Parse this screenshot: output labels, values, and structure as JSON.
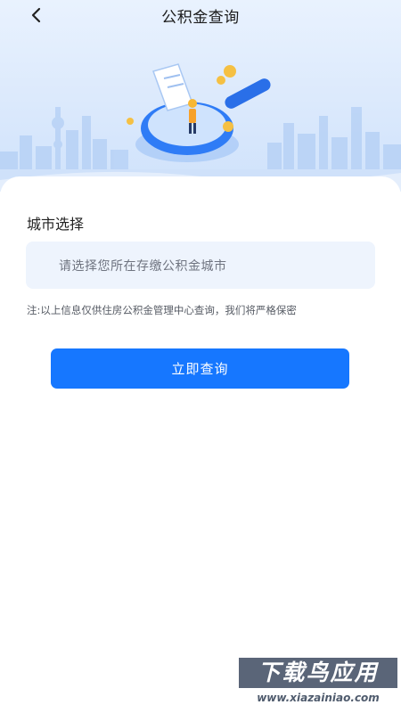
{
  "header": {
    "title": "公积金查询"
  },
  "form": {
    "section_label": "城市选择",
    "city_placeholder": "请选择您所在存缴公积金城市",
    "note": "注:以上信息仅供住房公积金管理中心查询，我们将严格保密",
    "submit_label": "立即查询"
  },
  "watermark": {
    "title": "下载鸟应用",
    "url": "www.xiazainiao.com"
  },
  "colors": {
    "primary": "#1677ff",
    "input_bg": "#eef4fd",
    "hero_bg": "#dbe9fc"
  },
  "icons": [
    "back-arrow-icon",
    "magnifier-illustration",
    "city-skyline-illustration"
  ]
}
